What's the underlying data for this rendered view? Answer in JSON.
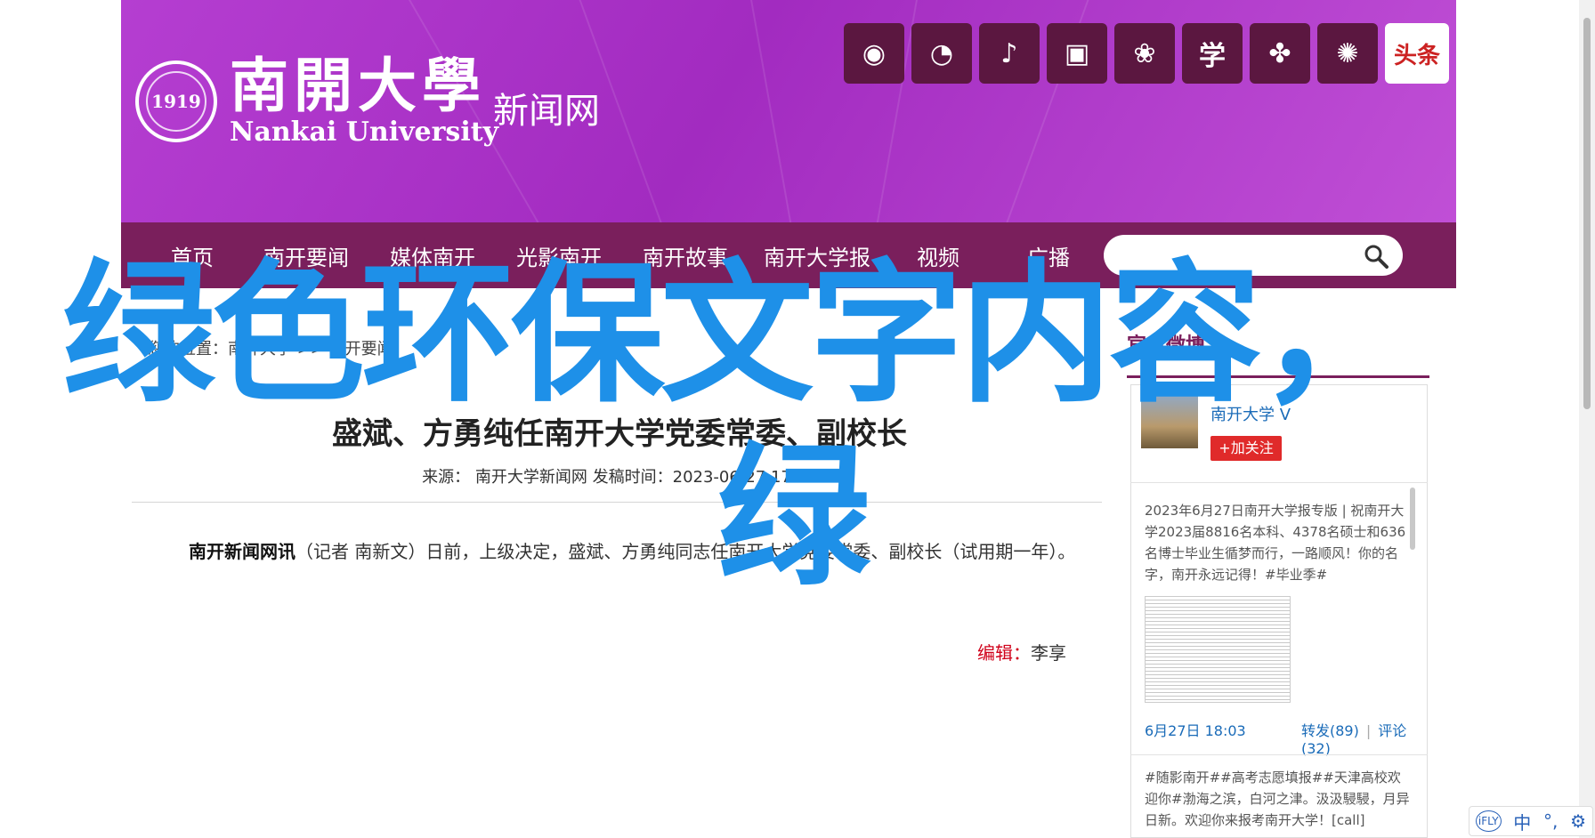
{
  "header": {
    "logo_cn": "南開大學",
    "logo_en": "Nankai University",
    "seal_text": "1919",
    "site_name": "新闻网",
    "social": [
      {
        "name": "wechat-icon",
        "glyph": "◉"
      },
      {
        "name": "weibo-icon",
        "glyph": "◔"
      },
      {
        "name": "tiktok-icon",
        "glyph": "♪"
      },
      {
        "name": "bilibili-icon",
        "glyph": "▣"
      },
      {
        "name": "kuaishou-icon",
        "glyph": "❀"
      },
      {
        "name": "xuexi-icon",
        "glyph": "学"
      },
      {
        "name": "app-icon",
        "glyph": "✤"
      },
      {
        "name": "feather-icon",
        "glyph": "✺"
      },
      {
        "name": "toutiao-icon",
        "glyph": "头条"
      }
    ]
  },
  "nav": {
    "items": [
      "首页",
      "南开要闻",
      "媒体南开",
      "光影南开",
      "南开故事",
      "南开大学报",
      "视频",
      "广播"
    ],
    "search_placeholder": ""
  },
  "article": {
    "breadcrumb": "您的位置：南开大学 >> 南开要闻",
    "title": "盛斌、方勇纯任南开大学党委常委、副校长",
    "meta": "来源：  南开大学新闻网   发稿时间：2023-06-27 17:41",
    "para_lead": "南开新闻网讯",
    "para_body": "（记者 南新文）日前，上级决定，盛斌、方勇纯同志任南开大学党委常委、副校长（试用期一年）。",
    "editor_label": "编辑：",
    "editor_name": "李享"
  },
  "weibo": {
    "title": "官方微博",
    "account_name": "南开大学 V",
    "follow_label": "+加关注",
    "post1": "2023年6月27日南开大学报专版 | 祝南开大学2023届8816名本科、4378名硕士和636名博士毕业生循梦而行，一路顺风！你的名字，南开永远记得！#毕业季#",
    "post1_date": "6月27日 18:03",
    "reposts": "转发(89)",
    "comments": "评论(32)",
    "post2": "#随影南开##高考志愿填报##天津高校欢迎你#渤海之滨，白河之津。汲汲駸駸，月异日新。欢迎你来报考南开大学！[call]"
  },
  "overlay": {
    "line1": "绿色环保文字内容，",
    "line2": "绿"
  },
  "ime": {
    "logo": "iFLY",
    "lang": "中",
    "dots": "°,",
    "settings": "⚙"
  },
  "colors": {
    "header_purple": "#b53ed1",
    "nav_purple": "#7a1f5c",
    "overlay_blue": "#1e90e8",
    "link_blue": "#1a6bb8",
    "editor_red": "#d0021b"
  }
}
